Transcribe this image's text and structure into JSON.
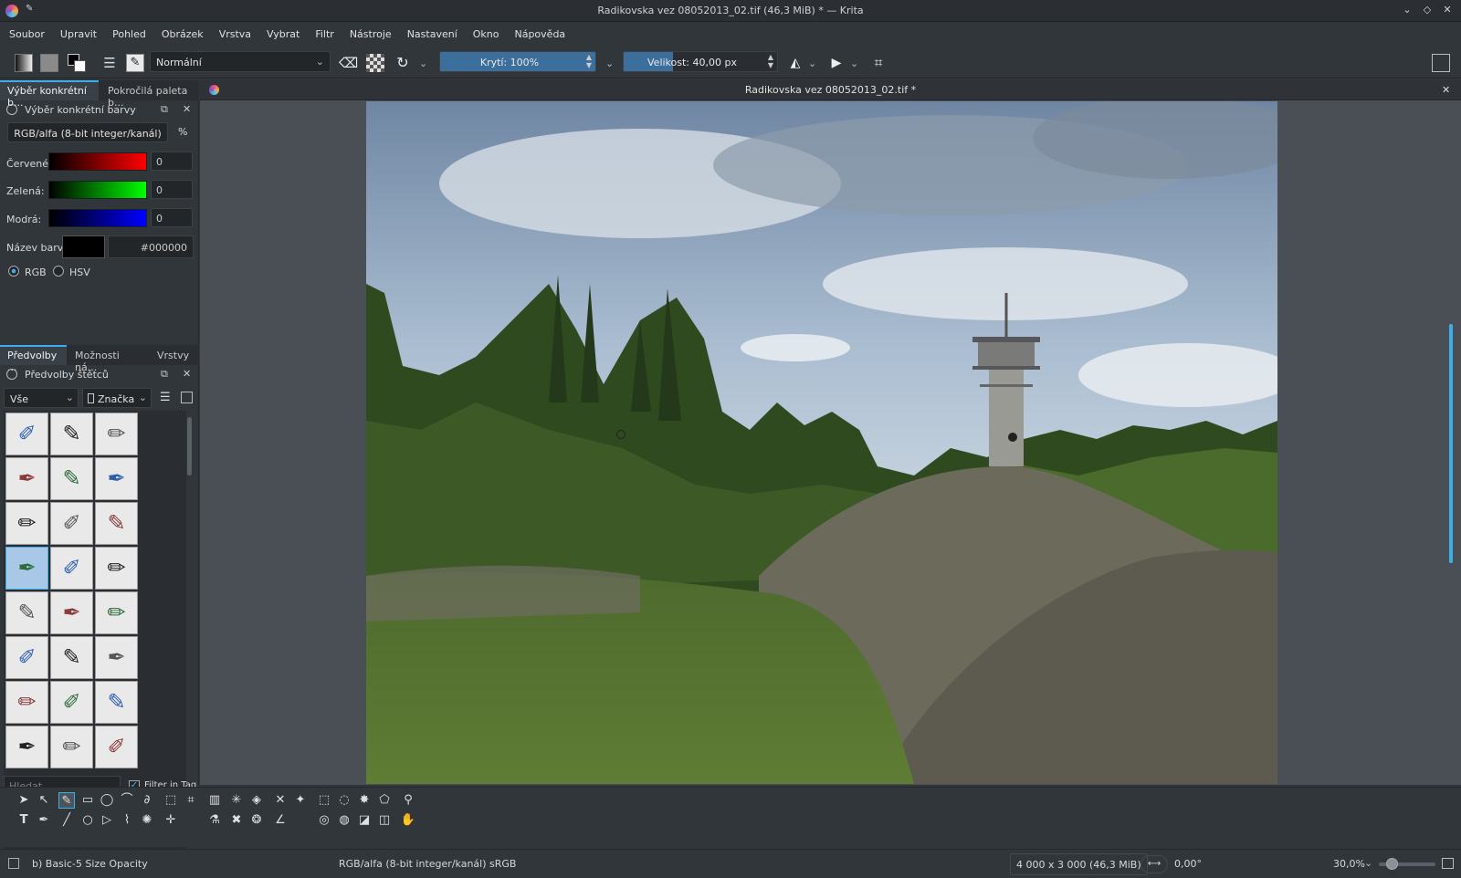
{
  "window": {
    "title": "Radikovska vez 08052013_02.tif (46,3 MiB) * — Krita"
  },
  "menu": [
    "Soubor",
    "Upravit",
    "Pohled",
    "Obrázek",
    "Vrstva",
    "Vybrat",
    "Filtr",
    "Nástroje",
    "Nastavení",
    "Okno",
    "Nápověda"
  ],
  "toolbar": {
    "blend_mode": "Normální",
    "opacity_label": "Krytí: 100%",
    "opacity_fraction": 1.0,
    "size_label": "Velikost: 40,00 px",
    "size_fraction": 0.32
  },
  "color_dock": {
    "tabs": [
      "Výběr konkrétní b...",
      "Pokročilá paleta b..."
    ],
    "panel_title": "Výběr konkrétní barvy",
    "color_model": "RGB/alfa (8-bit integer/kanál)",
    "percent_symbol": "%",
    "channels": [
      {
        "label": "Červené:",
        "value": "0"
      },
      {
        "label": "Zelená:",
        "value": "0"
      },
      {
        "label": "Modrá:",
        "value": "0"
      }
    ],
    "name_label": "Název barvy:",
    "hex_value": "#000000",
    "radio_rgb": "RGB",
    "radio_hsv": "HSV"
  },
  "brush_dock": {
    "tabs": [
      "Předvolby ...",
      "Možnosti ná...",
      "Vrstvy"
    ],
    "panel_title": "Předvolby štětců",
    "filter_value": "Vše",
    "tag_value": "Značka",
    "search_placeholder": "Hledat",
    "filter_in_tag": "Filter in Tag"
  },
  "document": {
    "tab_title": "Radikovska vez 08052013_02.tif *"
  },
  "status": {
    "brush_preset": "b) Basic-5 Size Opacity",
    "color_profile": "RGB/alfa (8-bit integer/kanál)  sRGB",
    "image_size": "4 000 x 3 000 (46,3 MiB)",
    "rotation": "0,00°",
    "zoom": "30,0%"
  }
}
